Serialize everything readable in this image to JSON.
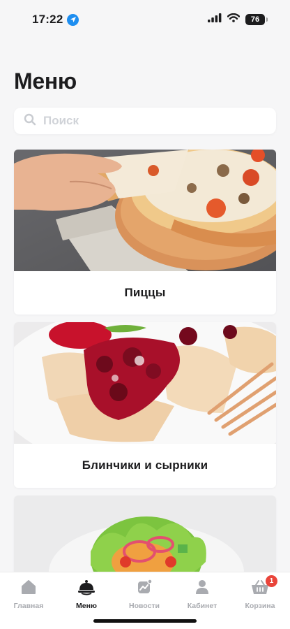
{
  "status_bar": {
    "time": "17:22",
    "battery": "76"
  },
  "page": {
    "title": "Меню"
  },
  "search": {
    "placeholder": "Поиск"
  },
  "categories": [
    {
      "label": "Пиццы",
      "image": "pizza"
    },
    {
      "label": "Блинчики и сырники",
      "image": "pancakes-with-cherry"
    },
    {
      "label": "",
      "image": "salad"
    }
  ],
  "tab_bar": {
    "active": "menu",
    "tabs": [
      {
        "id": "home",
        "label": "Главная",
        "icon": "home-icon"
      },
      {
        "id": "menu",
        "label": "Меню",
        "icon": "cloche-icon"
      },
      {
        "id": "news",
        "label": "Новости",
        "icon": "news-icon"
      },
      {
        "id": "cabinet",
        "label": "Кабинет",
        "icon": "user-icon"
      },
      {
        "id": "cart",
        "label": "Корзина",
        "icon": "basket-icon",
        "badge": "1"
      }
    ]
  },
  "colors": {
    "background": "#f6f6f7",
    "text": "#1c1c1e",
    "inactive_tab": "#a9abb0",
    "badge": "#e9443a",
    "location": "#1e8ef0"
  }
}
